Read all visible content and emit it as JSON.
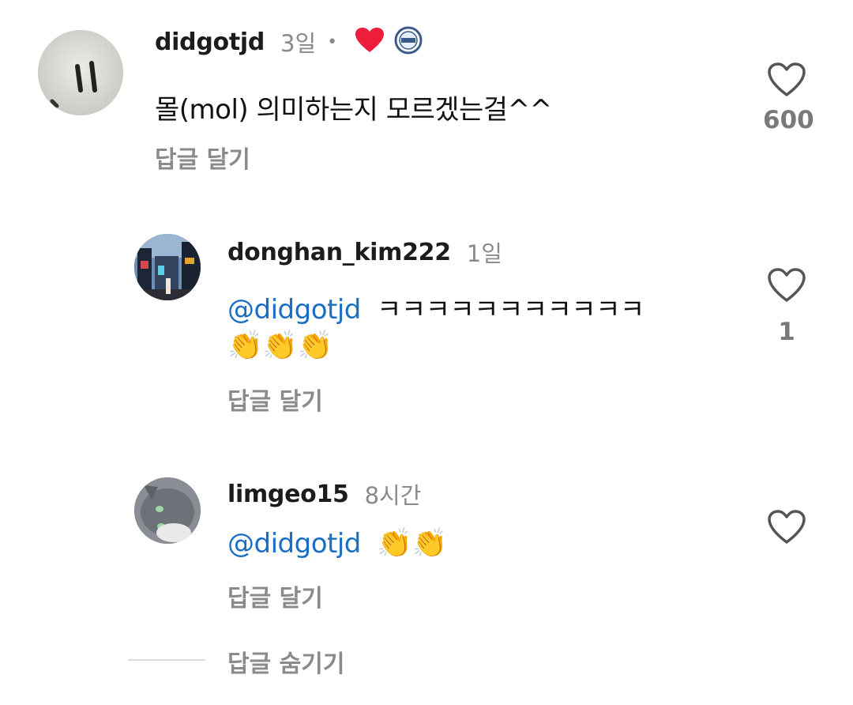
{
  "comments": [
    {
      "username": "didgotjd",
      "time": "3일",
      "separator": "•",
      "text": "몰(mol) 의미하는지 모르겠는걸^^",
      "reply_label": "답글 달기",
      "like_count": "600",
      "badges": [
        "heart-badge",
        "creator-badge"
      ],
      "badge_color": "#ee1d3b"
    },
    {
      "username": "donghan_kim222",
      "time": "1일",
      "mention": "@didgotjd",
      "text": "ㅋㅋㅋㅋㅋㅋㅋㅋㅋㅋㅋ",
      "emoji_line": "👏👏👏",
      "reply_label": "답글 달기",
      "like_count": "1"
    },
    {
      "username": "limgeo15",
      "time": "8시간",
      "mention": "@didgotjd",
      "emoji_line": "👏👏",
      "reply_label": "답글 달기",
      "like_count": ""
    }
  ],
  "hide_replies_label": "답글 숨기기",
  "colors": {
    "mention": "#1a6fc4",
    "muted": "#8a8a8a",
    "heart": "#ee1d3b"
  }
}
